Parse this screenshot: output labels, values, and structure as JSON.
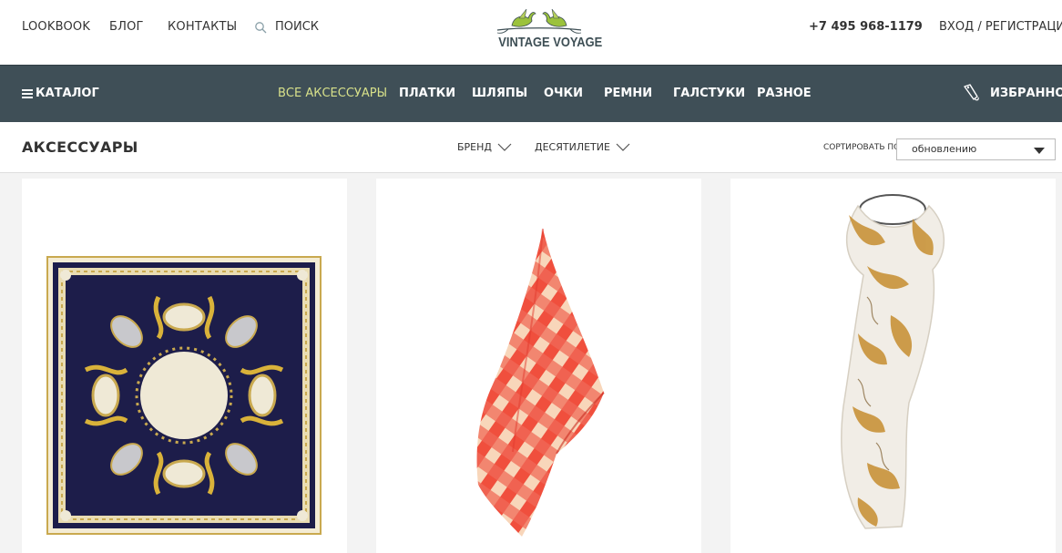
{
  "header": {
    "links": [
      "LOOKBOOK",
      "БЛОГ",
      "КОНТАКТЫ"
    ],
    "search_label": "ПОИСК",
    "logo_text": "VINTAGE VOYAGE",
    "phone": "+7 495 968-1179",
    "login": "ВХОД / РЕГИСТРАЦИЯ"
  },
  "nav": {
    "catalog": "КАТАЛОГ",
    "items": [
      "ВСЕ АКСЕССУАРЫ",
      "ПЛАТКИ",
      "ШЛЯПЫ",
      "ОЧКИ",
      "РЕМНИ",
      "ГАЛСТУКИ",
      "РАЗНОЕ"
    ],
    "active_item": "ВСЕ АКСЕССУАРЫ",
    "favorites": "ИЗБРАННОЕ"
  },
  "filters": {
    "page_title": "АКСЕССУАРЫ",
    "brand": "БРЕНД",
    "decade": "ДЕСЯТИЛЕТИЕ",
    "sort_label": "СОРТИРОВАТЬ ПО:",
    "sort_value": "обновлению"
  },
  "products": [
    {
      "icon": "navy-gold-silk-scarf-image"
    },
    {
      "icon": "red-checked-scarf-image"
    },
    {
      "icon": "white-gold-baroque-scarf-image"
    }
  ],
  "colors": {
    "nav_bg": "#3f4f57",
    "nav_active": "#d7e08a",
    "grid_bg": "#f3f3f3",
    "logo_green": "#9bc23c"
  }
}
